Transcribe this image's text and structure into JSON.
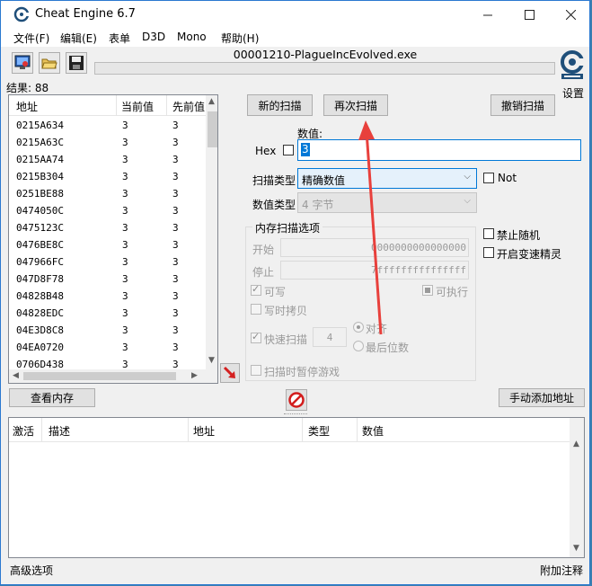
{
  "window": {
    "title": "Cheat Engine 6.7",
    "process": "00001210-PlagueIncEvolved.exe"
  },
  "menu": [
    "文件(F)",
    "编辑(E)",
    "表单",
    "D3D",
    "Mono",
    "帮助(H)"
  ],
  "settings_label": "设置",
  "results": "结果: 88",
  "address_list": {
    "headers": [
      "地址",
      "当前值",
      "先前值"
    ],
    "rows": [
      {
        "addr": "0215A634",
        "cur": "3",
        "prev": "3"
      },
      {
        "addr": "0215A63C",
        "cur": "3",
        "prev": "3"
      },
      {
        "addr": "0215AA74",
        "cur": "3",
        "prev": "3"
      },
      {
        "addr": "0215B304",
        "cur": "3",
        "prev": "3"
      },
      {
        "addr": "0251BE88",
        "cur": "3",
        "prev": "3"
      },
      {
        "addr": "0474050C",
        "cur": "3",
        "prev": "3"
      },
      {
        "addr": "0475123C",
        "cur": "3",
        "prev": "3"
      },
      {
        "addr": "0476BE8C",
        "cur": "3",
        "prev": "3"
      },
      {
        "addr": "047966FC",
        "cur": "3",
        "prev": "3"
      },
      {
        "addr": "047D8F78",
        "cur": "3",
        "prev": "3"
      },
      {
        "addr": "04828B48",
        "cur": "3",
        "prev": "3"
      },
      {
        "addr": "04828EDC",
        "cur": "3",
        "prev": "3"
      },
      {
        "addr": "04E3D8C8",
        "cur": "3",
        "prev": "3"
      },
      {
        "addr": "04EA0720",
        "cur": "3",
        "prev": "3"
      },
      {
        "addr": "0706D438",
        "cur": "3",
        "prev": "3"
      }
    ]
  },
  "buttons": {
    "new_scan": "新的扫描",
    "next_scan": "再次扫描",
    "undo_scan": "撤销扫描",
    "view_memory": "查看内存",
    "add_address": "手动添加地址"
  },
  "value": {
    "label": "数值:",
    "hex_label": "Hex",
    "current": "3"
  },
  "scan_type": {
    "label": "扫描类型",
    "selected": "精确数值",
    "not_label": "Not"
  },
  "value_type": {
    "label": "数值类型",
    "selected": "4 字节"
  },
  "memory_options": {
    "title": "内存扫描选项",
    "start_label": "开始",
    "start_value": "0000000000000000",
    "stop_label": "停止",
    "stop_value": "7fffffffffffffff",
    "writable": "可写",
    "executable": "可执行",
    "copy_on_write": "写时拷贝",
    "fast_scan": "快速扫描",
    "fast_scan_value": "4",
    "align": "对齐",
    "last_digits": "最后位数",
    "pause_game": "扫描时暂停游戏"
  },
  "side_options": {
    "disable_random": "禁止随机",
    "speedhack": "开启变速精灵"
  },
  "cheat_table": {
    "headers": [
      "激活",
      "描述",
      "地址",
      "类型",
      "数值"
    ]
  },
  "status": {
    "left": "高级选项",
    "right": "附加注释"
  },
  "colors": {
    "accent": "#0078d7",
    "annotation_arrow": "#e8403c"
  }
}
